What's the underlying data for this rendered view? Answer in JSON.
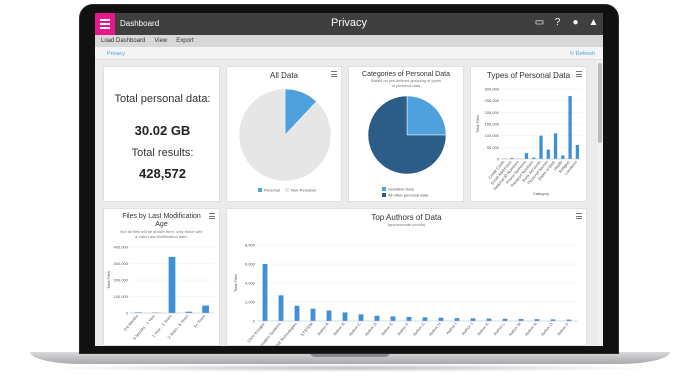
{
  "topbar": {
    "crumb": "Dashboard",
    "title": "Privacy"
  },
  "menubar": {
    "items": [
      "Load Dashboard",
      "View",
      "Export"
    ]
  },
  "tabbar": {
    "tab": "Privacy",
    "refresh": "Refresh"
  },
  "summary": {
    "label1": "Total personal data:",
    "value1": "30.02 GB",
    "label2": "Total results:",
    "value2": "428,572"
  },
  "all_data": {
    "title": "All Data",
    "legend": [
      "Personal",
      "Non-Personal"
    ],
    "colors": [
      "#4ea1dc",
      "#e6e6e6"
    ]
  },
  "categories": {
    "title": "Categories of Personal Data",
    "subtitle": "Based on pre-defined grouping of types of personal data",
    "legend": [
      "Sensitive Data",
      "All other personal data"
    ],
    "colors": [
      "#4ea1dc",
      "#2c5d87"
    ]
  },
  "types": {
    "title": "Types of Personal Data",
    "ylabel": "Total Files",
    "xlabel": "Category",
    "yticks": [
      "300,000",
      "250,000",
      "200,000",
      "150,000",
      "100,000",
      "50,000",
      "0"
    ]
  },
  "mod_age": {
    "title": "Files by Last Modification Age",
    "subtitle": "Not all files will be shown here, only those with a valid Last Modification date.",
    "ylabel": "Total Files",
    "yticks": [
      "400,000",
      "300,000",
      "200,000",
      "100,000",
      "0"
    ]
  },
  "authors": {
    "title": "Top Authors of Data",
    "subtitle": "(approximate counts)",
    "ylabel": "Total Files",
    "yticks": [
      "8,000",
      "6,000",
      "4,000",
      "2,000",
      "0"
    ]
  },
  "chart_data": [
    {
      "type": "pie",
      "title": "All Data",
      "categories": [
        "Personal",
        "Non-Personal"
      ],
      "values": [
        12,
        88
      ]
    },
    {
      "type": "pie",
      "title": "Categories of Personal Data",
      "categories": [
        "Sensitive Data",
        "All other personal data"
      ],
      "values": [
        25,
        75
      ]
    },
    {
      "type": "bar",
      "title": "Types of Personal Data",
      "ylabel": "Total Files",
      "xlabel": "Category",
      "ylim": [
        0,
        300000
      ],
      "categories": [
        "Credit Cards",
        "Email Addresses",
        "National ID Numbers",
        "Phone Numbers",
        "Passport Numbers",
        "Bank Accounts",
        "Personal Names",
        "Dates of Birth",
        "Health",
        "Religion",
        "Locations"
      ],
      "values": [
        2000,
        4000,
        1500,
        25000,
        6000,
        100000,
        40000,
        110000,
        15000,
        270000,
        60000
      ]
    },
    {
      "type": "bar",
      "title": "Files by Last Modification Age",
      "ylabel": "Total Files",
      "ylim": [
        0,
        400000
      ],
      "categories": [
        "0-6 Months",
        "6 Months - 1 Year",
        "1 Year - 2 Years",
        "2 Years - 5 Years",
        "5+ Years"
      ],
      "values": [
        4000,
        3000,
        340000,
        8000,
        45000
      ]
    },
    {
      "type": "bar",
      "title": "Top Authors of Data",
      "subtitle": "(approximate counts)",
      "ylabel": "Total Files",
      "ylim": [
        0,
        8000
      ],
      "categories": [
        "Chris Kreuger",
        "Information Systems",
        "Dell Technologies",
        "SYSTEM",
        "Author A",
        "Author B",
        "Author C",
        "Author D",
        "Author E",
        "Author F",
        "Author G",
        "Author H",
        "Author I",
        "Author J",
        "Author K",
        "Author L",
        "Author M",
        "Author N",
        "Author O",
        "Author P"
      ],
      "values": [
        6000,
        2700,
        1600,
        1300,
        1100,
        900,
        700,
        550,
        480,
        420,
        380,
        340,
        300,
        280,
        250,
        230,
        210,
        190,
        170,
        150
      ]
    }
  ]
}
